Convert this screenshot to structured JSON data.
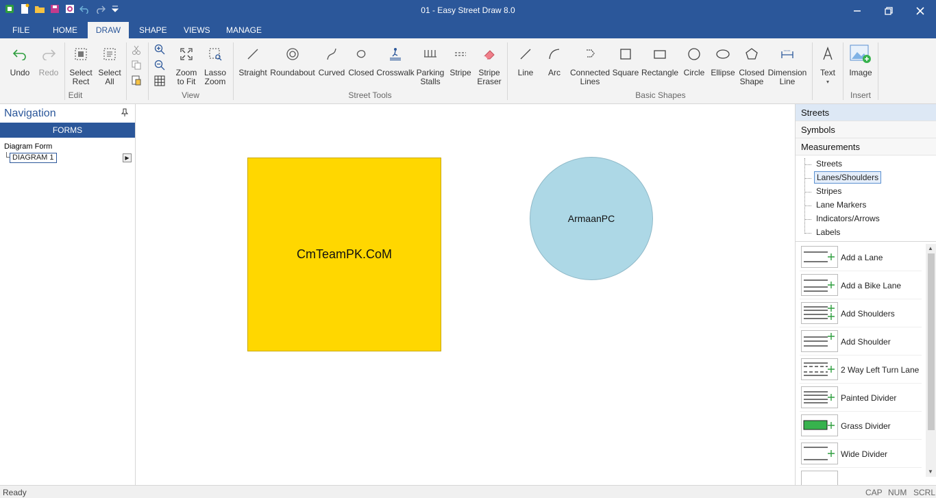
{
  "window": {
    "title": "01 - Easy Street Draw 8.0",
    "controls": [
      "minimize-icon",
      "restore-icon",
      "close-icon"
    ]
  },
  "quick_access": [
    "app-icon",
    "new-icon",
    "open-icon",
    "save-icon",
    "print-preview-icon",
    "undo-icon",
    "redo-icon",
    "customize-icon"
  ],
  "tabs": [
    {
      "label": "FILE"
    },
    {
      "label": "HOME"
    },
    {
      "label": "DRAW",
      "active": true
    },
    {
      "label": "SHAPE"
    },
    {
      "label": "VIEWS"
    },
    {
      "label": "MANAGE"
    }
  ],
  "ribbon": {
    "edit": {
      "label": "Edit",
      "undo": "Undo",
      "redo": "Redo",
      "select_rect_1": "Select",
      "select_rect_2": "Rect",
      "select_all_1": "Select",
      "select_all_2": "All"
    },
    "view": {
      "label": "View",
      "zoom_fit_1": "Zoom",
      "zoom_fit_2": "to Fit",
      "lasso_1": "Lasso",
      "lasso_2": "Zoom"
    },
    "street_tools": {
      "label": "Street Tools",
      "straight": "Straight",
      "roundabout": "Roundabout",
      "curved": "Curved",
      "closed": "Closed",
      "crosswalk": "Crosswalk",
      "parking_1": "Parking",
      "parking_2": "Stalls",
      "stripe": "Stripe",
      "stripe_eraser_1": "Stripe",
      "stripe_eraser_2": "Eraser"
    },
    "basic_shapes": {
      "label": "Basic Shapes",
      "line": "Line",
      "arc": "Arc",
      "connected_1": "Connected",
      "connected_2": "Lines",
      "square": "Square",
      "rectangle": "Rectangle",
      "circle": "Circle",
      "ellipse": "Ellipse",
      "closed_shape_1": "Closed",
      "closed_shape_2": "Shape",
      "dimension_1": "Dimension",
      "dimension_2": "Line",
      "text": "Text"
    },
    "insert": {
      "label": "Insert",
      "image": "Image"
    }
  },
  "navigation": {
    "title": "Navigation",
    "forms_label": "FORMS",
    "tree_root": "Diagram Form",
    "tree_child": "DIAGRAM 1"
  },
  "canvas": {
    "square_text": "CmTeamPK.CoM",
    "square_color": "#ffd700",
    "circle_text": "ArmaanPC",
    "circle_color": "#add8e6"
  },
  "right_panel": {
    "categories": [
      "Streets",
      "Symbols",
      "Measurements"
    ],
    "subitems": [
      "Streets",
      "Lanes/Shoulders",
      "Stripes",
      "Lane Markers",
      "Indicators/Arrows",
      "Labels"
    ],
    "selected_subitem": "Lanes/Shoulders",
    "palette": [
      {
        "label": "Add a Lane"
      },
      {
        "label": "Add a Bike Lane"
      },
      {
        "label": "Add Shoulders"
      },
      {
        "label": "Add Shoulder"
      },
      {
        "label": "2 Way Left Turn Lane"
      },
      {
        "label": "Painted Divider"
      },
      {
        "label": "Grass Divider"
      },
      {
        "label": "Wide Divider"
      }
    ]
  },
  "status": {
    "ready": "Ready",
    "cap": "CAP",
    "num": "NUM",
    "scrl": "SCRL"
  },
  "colors": {
    "accent": "#2b579a",
    "ribbon_bg": "#f3f3f3",
    "add_icon": "#2e9e3e"
  }
}
